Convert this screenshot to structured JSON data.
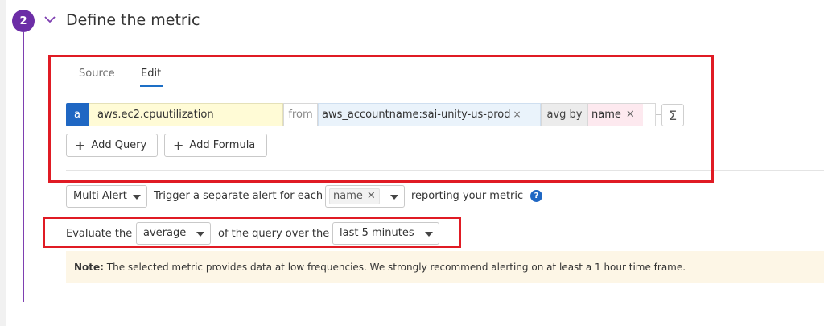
{
  "step": {
    "number": "2",
    "title": "Define the metric",
    "accent_color": "#6c2da6"
  },
  "tabs": [
    {
      "label": "Source",
      "active": false
    },
    {
      "label": "Edit",
      "active": true
    }
  ],
  "query": {
    "letter": "a",
    "metric": "aws.ec2.cpuutilization",
    "from_label": "from",
    "from_tag": "aws_accountname:sai-unity-us-prod",
    "from_tag_remove": "×",
    "aggregation_label": "avg by",
    "group_by": "name",
    "group_by_remove": "✕",
    "formula_icon": "Σ"
  },
  "buttons": {
    "add_query": "Add Query",
    "add_formula": "Add Formula"
  },
  "alert": {
    "type_value": "Multi Alert",
    "trigger_text": "Trigger a separate alert for each",
    "group_value": "name",
    "group_remove": "✕",
    "reporting_text": "reporting your metric",
    "help": "?"
  },
  "evaluation": {
    "prefix": "Evaluate the",
    "aggregation_value": "average",
    "middle": "of the query over the",
    "window_value": "last 5 minutes"
  },
  "note": {
    "label": "Note:",
    "text": " The selected metric provides data at low frequencies. We strongly recommend alerting on at least a 1 hour time frame."
  },
  "colors": {
    "highlight": "#e01b24",
    "primary": "#1f67c3",
    "metric_bg": "#fffbd6",
    "tag_bg": "#eaf3fb",
    "group_bg": "#fde9ef",
    "note_bg": "#fdf6e6"
  }
}
